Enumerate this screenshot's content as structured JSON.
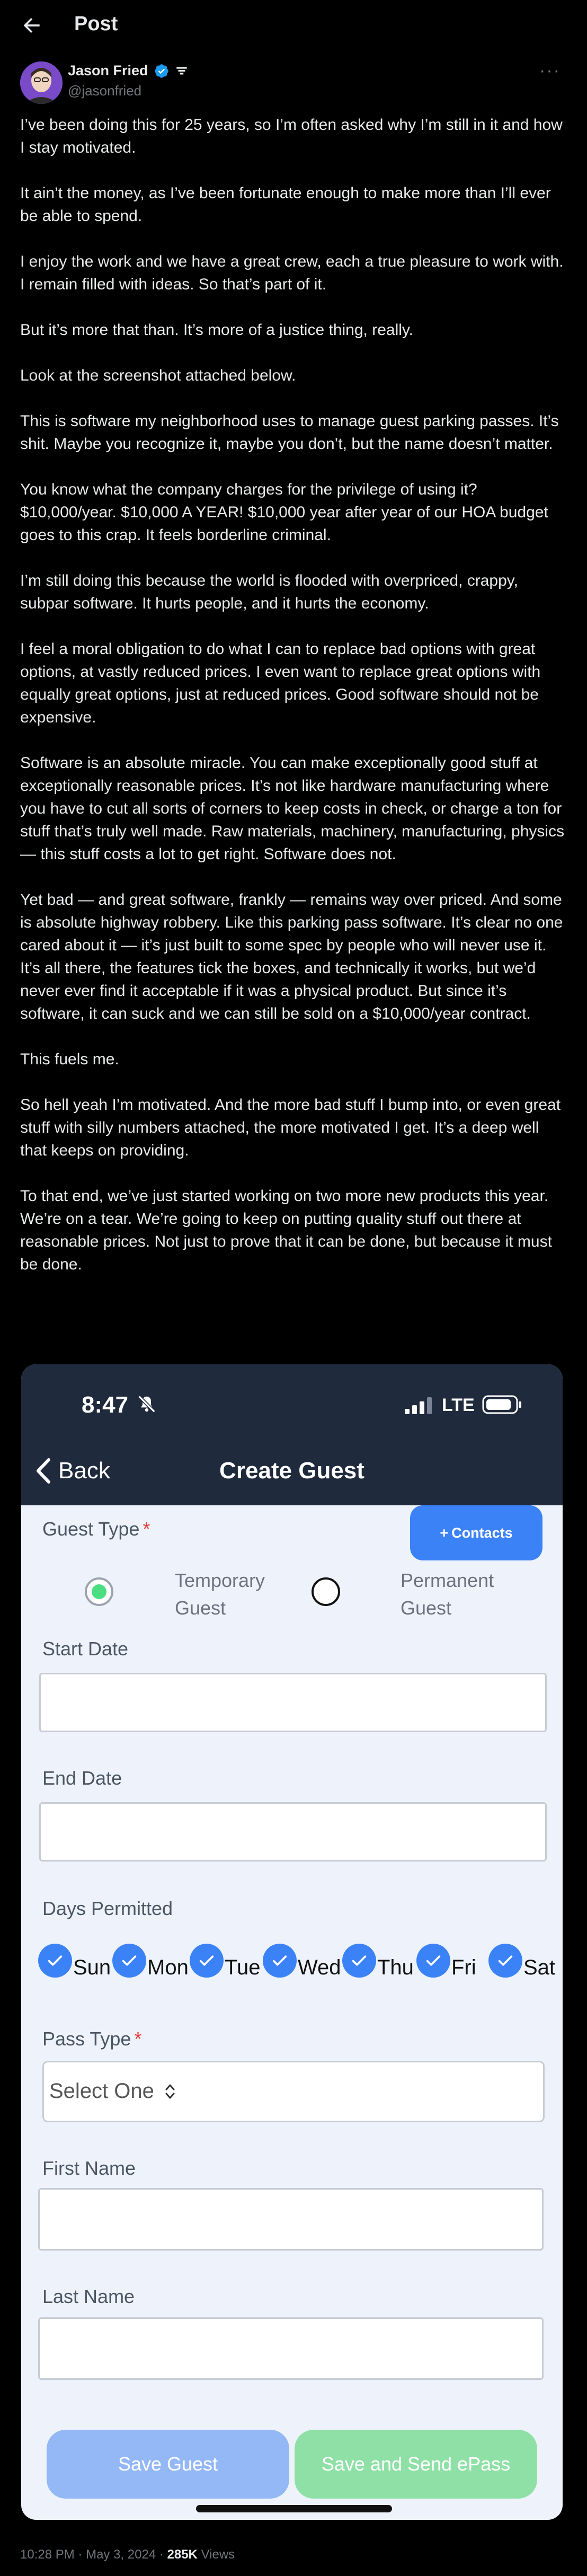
{
  "header": {
    "title": "Post"
  },
  "author": {
    "name": "Jason Fried",
    "handle": "@jasonfried"
  },
  "post": {
    "paragraphs": [
      "I’ve been doing this for 25 years, so I’m often asked why I’m still in it and how I stay motivated.",
      "It ain’t the money, as I’ve been fortunate enough to make more than I’ll ever be able to spend.",
      "I enjoy the work and we have a great crew, each a true pleasure to work with. I remain filled with ideas. So that’s part of it.",
      "But it’s more that than. It’s more of a justice thing, really.",
      "Look at the screenshot attached below.",
      "This is software my neighborhood uses to manage guest parking passes. It’s shit. Maybe you recognize it, maybe you don’t, but the name doesn’t matter.",
      "You know what the company charges for the privilege of using it? $10,000/year. $10,000 A YEAR! $10,000 year after year of our HOA budget goes to this crap. It feels borderline criminal.",
      "I’m still doing this because the world is flooded with overpriced, crappy, subpar software. It hurts people, and it hurts the economy.",
      "I feel a moral obligation to do what I can to replace bad options with great options, at vastly reduced prices. I even want to replace great options with equally great options, just at reduced prices. Good software should not be expensive.",
      "Software is an absolute miracle. You can make exceptionally good stuff at exceptionally reasonable prices. It’s not like hardware manufacturing where you have to cut all sorts of corners to keep costs in check, or charge a ton for stuff that’s truly well made. Raw materials, machinery, manufacturing, physics — this stuff costs a lot to get right. Software does not.",
      "Yet bad — and great software, frankly — remains way over priced. And some is absolute highway robbery. Like this parking pass software. It’s clear no one cared about it — it’s just built to some spec by people who will never use it. It’s all there, the features tick the boxes, and technically it works, but we’d never ever find it acceptable if it was a physical product. But since it’s software, it can suck and we can still be sold on a $10,000/year contract.",
      "This fuels me.",
      "So hell yeah I’m motivated. And the more bad stuff I bump into, or even great stuff with silly numbers attached, the more motivated I get. It’s a deep well that keeps on providing.",
      "To that end, we’ve just started working on two more new products this year. We’re on a tear. We’re going to keep on putting quality stuff out there at reasonable prices. Not just to prove that it can be done, but because it must be done."
    ]
  },
  "screenshot": {
    "status_bar": {
      "time": "8:47",
      "network": "LTE"
    },
    "nav": {
      "back": "Back",
      "title": "Create Guest"
    },
    "guest_type": {
      "label": "Guest Type",
      "required_mark": "*",
      "contacts_button": "Contacts",
      "options": [
        "Temporary Guest",
        "Permanent Guest"
      ],
      "selected": "Temporary Guest"
    },
    "start_date": {
      "label": "Start Date",
      "value": ""
    },
    "end_date": {
      "label": "End Date",
      "value": ""
    },
    "days_permitted": {
      "label": "Days Permitted",
      "days": [
        "Sun",
        "Mon",
        "Tue",
        "Wed",
        "Thu",
        "Fri",
        "Sat"
      ]
    },
    "pass_type": {
      "label": "Pass Type",
      "required_mark": "*",
      "value": "Select One"
    },
    "first_name": {
      "label": "First Name",
      "value": ""
    },
    "last_name": {
      "label": "Last Name",
      "value": ""
    },
    "buttons": {
      "save": "Save Guest",
      "save_send": "Save and Send ePass"
    }
  },
  "footer": {
    "time": "10:28 PM",
    "separator": "·",
    "date": "May 3, 2024",
    "views_count": "285K",
    "views_label": "Views"
  }
}
